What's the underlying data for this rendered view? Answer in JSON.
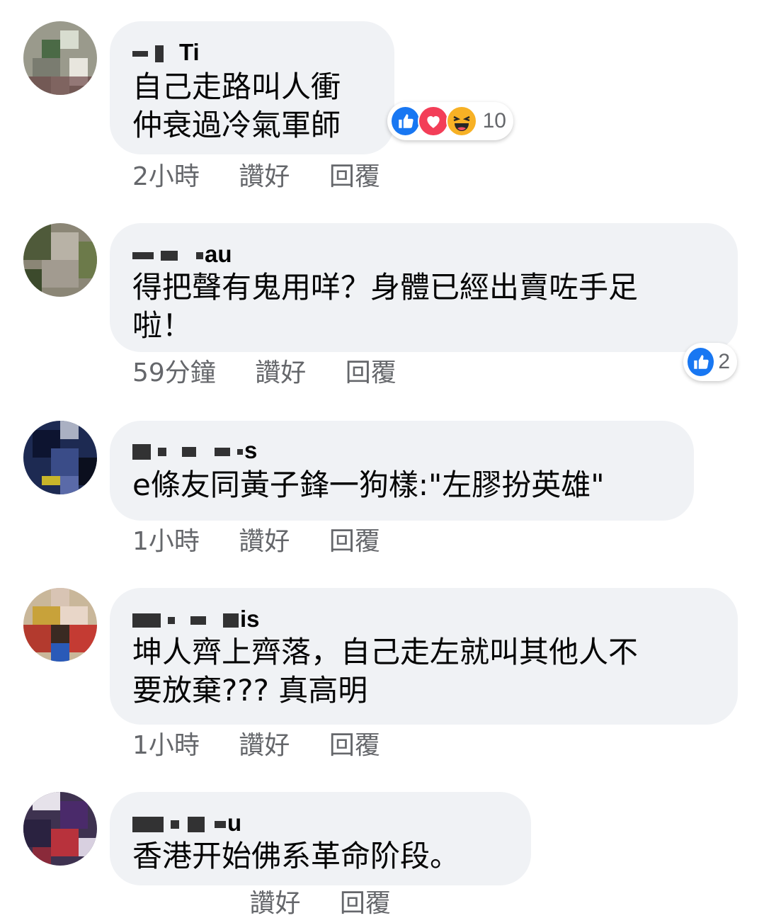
{
  "comments": [
    {
      "name_visible": "Ti",
      "text_lines": [
        "自己走路叫人衝",
        "仲衰過冷氣軍師"
      ],
      "time": "2小時",
      "like_label": "讚好",
      "reply_label": "回覆",
      "reactions": {
        "icons": [
          "like-icon",
          "love-icon",
          "haha-icon"
        ],
        "count": "10"
      }
    },
    {
      "name_visible": "au",
      "text_lines": [
        "得把聲有鬼用咩？身體已經出賣咗手足",
        "啦！"
      ],
      "time": "59分鐘",
      "like_label": "讚好",
      "reply_label": "回覆",
      "reactions": {
        "icons": [
          "like-icon"
        ],
        "count": "2"
      }
    },
    {
      "name_visible": "s",
      "text_lines": [
        "e條友同黃子鋒一狗樣:\"左膠扮英雄\""
      ],
      "time": "1小時",
      "like_label": "讚好",
      "reply_label": "回覆"
    },
    {
      "name_visible": "is",
      "text_lines": [
        "坤人齊上齊落，自己走左就叫其他人不",
        "要放棄??? 真高明"
      ],
      "time": "1小時",
      "like_label": "讚好",
      "reply_label": "回覆"
    },
    {
      "name_visible": "u",
      "text_lines": [
        "香港开始佛系革命阶段。"
      ],
      "time": "",
      "like_label": "讚好",
      "reply_label": "回覆"
    }
  ],
  "colors": {
    "bubble": "#f0f2f5",
    "meta_text": "#65676b",
    "like_blue": "#1877f2",
    "love_red": "#f33e58",
    "haha_yellow": "#f7b125"
  }
}
